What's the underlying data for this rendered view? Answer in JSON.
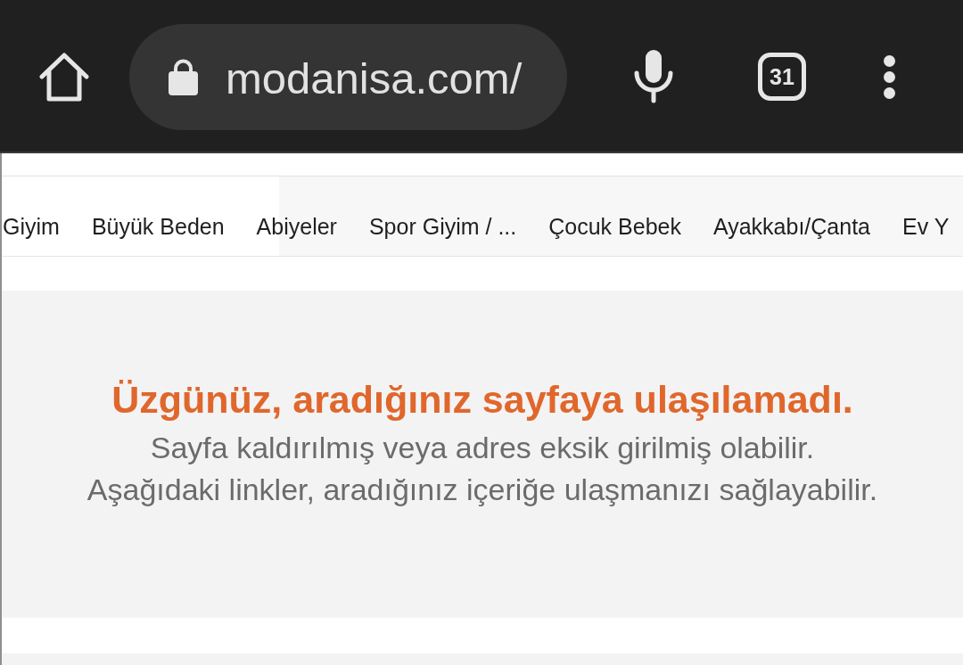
{
  "toolbar": {
    "url": "modanisa.com/",
    "tab_count": "31"
  },
  "category_nav": {
    "items": [
      "Giyim",
      "Büyük Beden",
      "Abiyeler",
      "Spor Giyim / ...",
      "Çocuk Bebek",
      "Ayakkabı/Çanta",
      "Ev Y"
    ]
  },
  "error_panel": {
    "title": "Üzgünüz, aradığınız sayfaya ulaşılamadı.",
    "lines": [
      "Sayfa kaldırılmış veya adres eksik girilmiş olabilir.",
      "Aşağıdaki linkler, aradığınız içeriğe ulaşmanızı sağlayabilir."
    ]
  }
}
